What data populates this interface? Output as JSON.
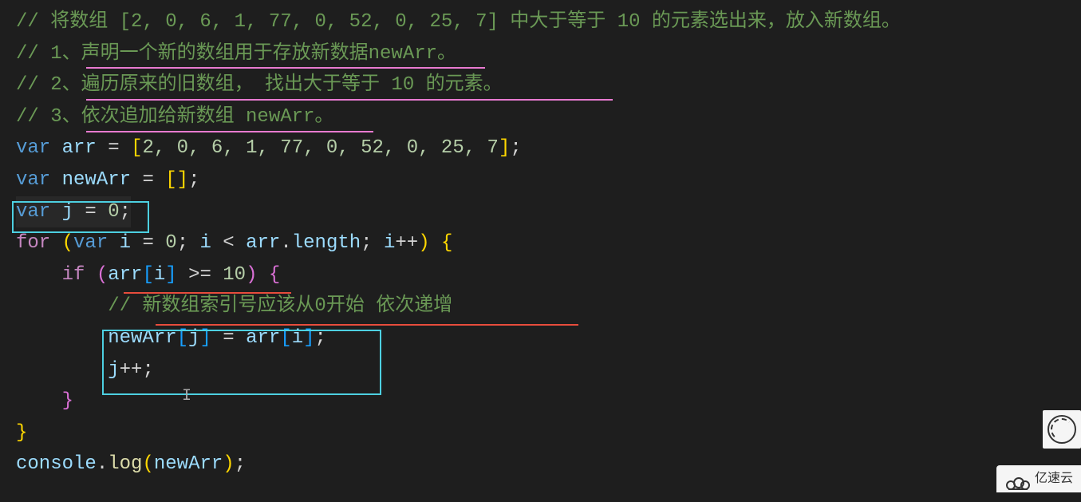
{
  "code": {
    "line1": {
      "prefix": "// ",
      "text": "将数组 [2, 0, 6, 1, 77, 0, 52, 0, 25, 7] 中大于等于 10 的元素选出来，放入新数组。"
    },
    "line2": {
      "prefix": "// ",
      "text": "1、声明一个新的数组用于存放新数据newArr。"
    },
    "line3": {
      "prefix": "// ",
      "text": "2、遍历原来的旧数组， 找出大于等于 10 的元素。"
    },
    "line4": {
      "prefix": "// ",
      "text": "3、依次追加给新数组 newArr。"
    },
    "line5": {
      "var_kw": "var",
      "var_name": "arr",
      "assign": " = ",
      "open": "[",
      "values": "2, 0, 6, 1, 77, 0, 52, 0, 25, 7",
      "close": "]",
      "semi": ";"
    },
    "line6": {
      "var_kw": "var",
      "var_name": "newArr",
      "assign": " = ",
      "open": "[",
      "close": "]",
      "semi": ";"
    },
    "line7": {
      "var_kw": "var",
      "var_name": "j",
      "assign": " = ",
      "value": "0",
      "semi": ";"
    },
    "line8": {
      "for_kw": "for",
      "open_paren": " (",
      "var_kw": "var",
      "var_i": " i",
      "assign": " = ",
      "zero": "0",
      "semi1": "; ",
      "i2": "i",
      "lt": " < ",
      "arr": "arr",
      "dot": ".",
      "length": "length",
      "semi2": "; ",
      "i3": "i",
      "inc": "++",
      "close_paren": ") ",
      "brace": "{"
    },
    "line9": {
      "if_kw": "if",
      "open_paren": " (",
      "arr": "arr",
      "open_bracket": "[",
      "i": "i",
      "close_bracket": "]",
      "gte": " >= ",
      "ten": "10",
      "close_paren": ") ",
      "brace": "{"
    },
    "line10": {
      "prefix": "// ",
      "text": "新数组索引号应该从0开始 依次递增"
    },
    "line11": {
      "newArr": "newArr",
      "open_b1": "[",
      "j": "j",
      "close_b1": "]",
      "assign": " = ",
      "arr": "arr",
      "open_b2": "[",
      "i": "i",
      "close_b2": "]",
      "semi": ";"
    },
    "line12": {
      "j": "j",
      "inc": "++",
      "semi": ";"
    },
    "line13": {
      "brace": "}"
    },
    "line14": {
      "brace": "}"
    },
    "line15": {
      "console": "console",
      "dot": ".",
      "log": "log",
      "open_paren": "(",
      "newArr": "newArr",
      "close_paren": ")",
      "semi": ";"
    }
  },
  "watermarks": {
    "tm": "™",
    "brand": "亿速云"
  }
}
